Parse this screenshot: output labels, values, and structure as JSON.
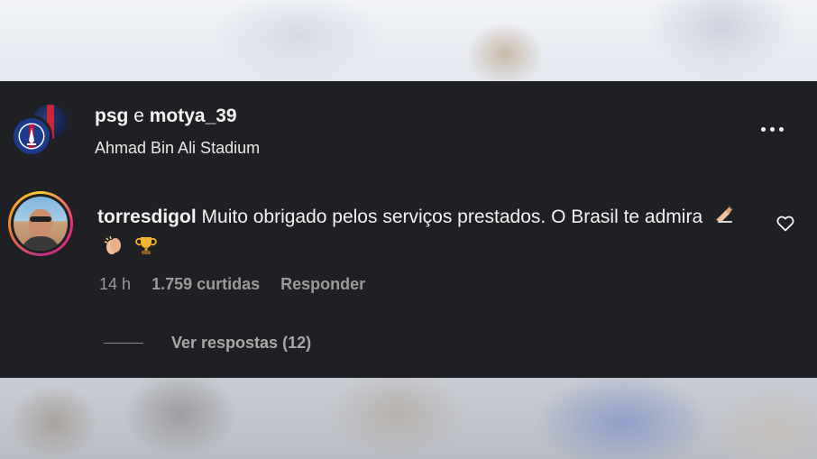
{
  "header": {
    "user1": "psg",
    "separator": "e",
    "user2": "motya_39",
    "location": "Ahmad Bin Ali Stadium",
    "more_icon": "more-horizontal-icon"
  },
  "comment": {
    "username": "torresdigol",
    "text": "Muito obrigado pelos serviços prestados. O Brasil te admira",
    "emojis": [
      "writing-hand-icon",
      "clapping-hands-icon",
      "trophy-icon"
    ],
    "time": "14 h",
    "likes": "1.759 curtidas",
    "reply_label": "Responder",
    "like_icon": "heart-outline-icon"
  },
  "replies": {
    "label": "Ver respostas (12)"
  },
  "colors": {
    "panel_bg": "#1f2024",
    "text_primary": "#f5f5f5",
    "text_secondary": "#9a9a9a",
    "psg_blue": "#1e3a8a",
    "psg_red": "#d21034"
  }
}
